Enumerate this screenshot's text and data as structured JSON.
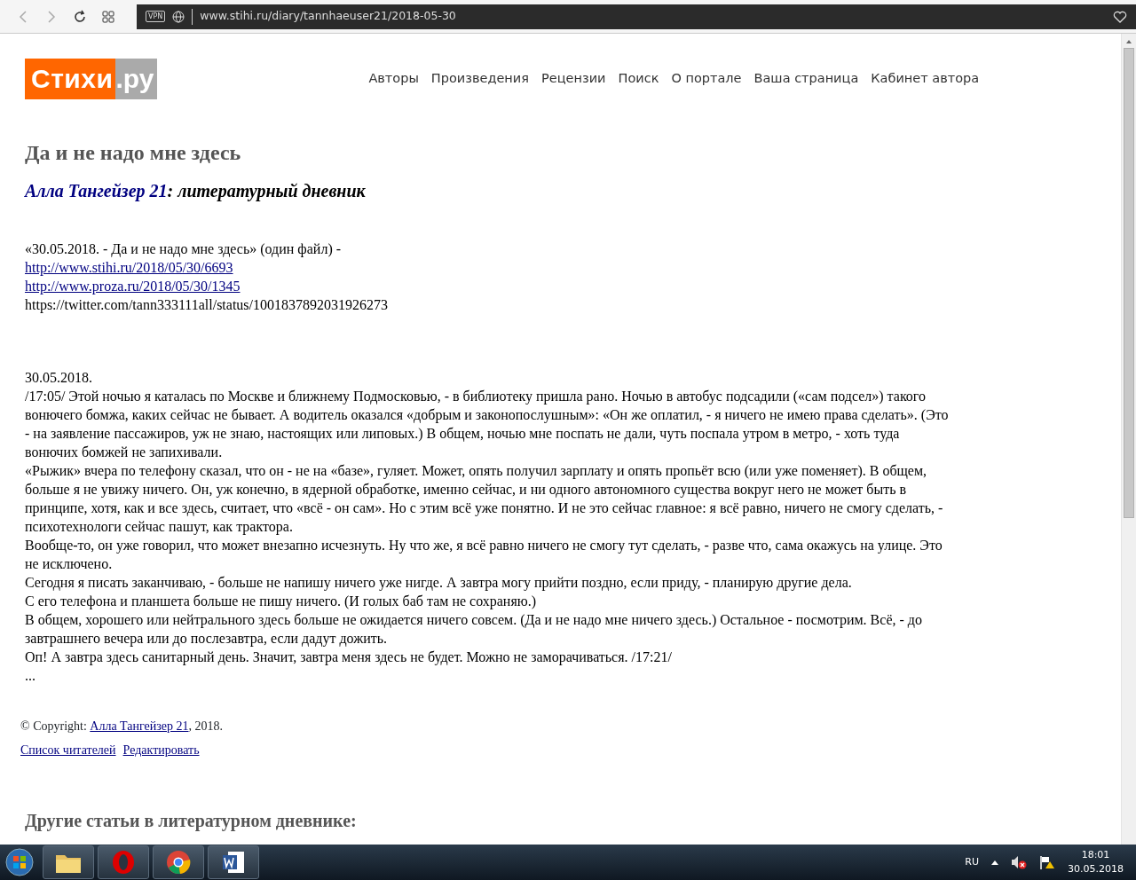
{
  "browser": {
    "vpn_label": "VPN",
    "url": "www.stihi.ru/diary/tannhaeuser21/2018-05-30"
  },
  "site": {
    "logo": {
      "main": "Стихи",
      "suffix": ".ру"
    },
    "nav": [
      "Авторы",
      "Произведения",
      "Рецензии",
      "Поиск",
      "О портале",
      "Ваша страница",
      "Кабинет автора"
    ]
  },
  "article": {
    "title": "Да и не надо мне здесь",
    "author": "Алла Тангейзер 21",
    "subtitle_rest": ": литературный дневник",
    "intro_lines": [
      {
        "kind": "plain",
        "text": "«30.05.2018. - Да и не надо мне здесь» (один файл) -"
      },
      {
        "kind": "link",
        "text": "http://www.stihi.ru/2018/05/30/6693"
      },
      {
        "kind": "link",
        "text": "http://www.proza.ru/2018/05/30/1345"
      },
      {
        "kind": "plain",
        "text": "https://twitter.com/tann333111all/status/1001837892031926273"
      }
    ],
    "date": "30.05.2018.",
    "paragraphs": [
      "/17:05/ Этой ночью я каталась по Москве и ближнему Подмосковью, - в библиотеку пришла рано. Ночью в автобус подсадили («сам подсел») такого вонючего бомжа, каких сейчас не бывает. А водитель оказался «добрым и законопослушным»: «Он же оплатил, - я ничего не имею права сделать». (Это - на заявление пассажиров, уж не знаю, настоящих или липовых.) В общем, ночью мне поспать не дали, чуть поспала утром в метро, - хоть туда вонючих бомжей не запихивали.",
      "«Рыжик» вчера по телефону сказал, что он - не на «базе», гуляет. Может, опять получил зарплату и опять пропьёт всю (или уже поменяет). В общем, больше я не увижу ничего. Он, уж конечно, в ядерной обработке, именно сейчас, и ни одного автономного существа вокруг него не может быть в принципе, хотя, как и все здесь, считает, что «всё - он сам». Но с этим всё уже понятно. И не это сейчас главное: я всё равно, ничего не смогу сделать, - психотехнологи сейчас пашут, как трактора.",
      "Вообще-то, он уже говорил, что может внезапно исчезнуть. Ну что же, я всё равно ничего не смогу тут сделать, - разве что, сама окажусь на улице. Это не исключено.",
      "Сегодня я писать заканчиваю, - больше не напишу ничего уже нигде. А завтра могу прийти поздно, если приду, - планирую другие дела.",
      "С его телефона и планшета больше не пишу ничего. (И голых баб там не сохраняю.)",
      "В общем, хорошего или нейтрального здесь больше не ожидается ничего совсем. (Да и не надо мне ничего здесь.) Остальное - посмотрим. Всё, - до завтрашнего вечера или до послезавтра, если дадут дожить.",
      "Оп! А завтра здесь санитарный день. Значит, завтра меня здесь не будет. Можно не заморачиваться. /17:21/",
      "..."
    ]
  },
  "footer": {
    "copyright_prefix": "© Copyright: ",
    "copyright_author": "Алла Тангейзер 21",
    "copyright_suffix": ", 2018.",
    "actions": [
      "Список читателей",
      "Редактировать"
    ],
    "other_heading": "Другие статьи в литературном дневнике:"
  },
  "taskbar": {
    "apps": [
      {
        "kind": "folder"
      },
      {
        "kind": "opera"
      },
      {
        "kind": "chrome"
      },
      {
        "kind": "word"
      }
    ],
    "language": "RU",
    "time": "18:01",
    "date": "30.05.2018"
  }
}
